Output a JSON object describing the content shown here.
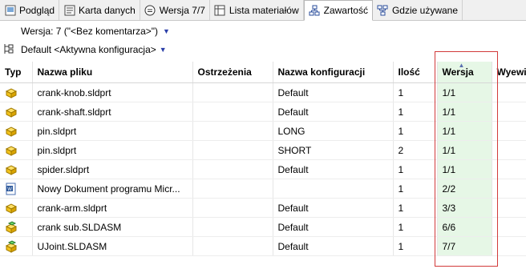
{
  "tabs": [
    {
      "label": "Podgląd",
      "icon": "preview-icon"
    },
    {
      "label": "Karta danych",
      "icon": "datacard-icon"
    },
    {
      "label": "Wersja 7/7",
      "icon": "version-icon"
    },
    {
      "label": "Lista materiałów",
      "icon": "bom-icon"
    },
    {
      "label": "Zawartość",
      "icon": "contains-icon",
      "active": true
    },
    {
      "label": "Gdzie używane",
      "icon": "where-used-icon"
    }
  ],
  "version_selector": {
    "label": "Wersja: 7 (\"<Bez komentarza>\")"
  },
  "config_selector": {
    "label": "Default <Aktywna konfiguracja>"
  },
  "columns": {
    "type": "Typ",
    "filename": "Nazwa pliku",
    "warnings": "Ostrzeżenia",
    "config": "Nazwa konfiguracji",
    "qty": "Ilość",
    "version": "Wersja",
    "checkout": "Wyewid"
  },
  "rows": [
    {
      "icon": "part-icon",
      "name": "crank-knob.sldprt",
      "warn": "",
      "config": "Default",
      "qty": "1",
      "version": "1/1"
    },
    {
      "icon": "part-icon",
      "name": "crank-shaft.sldprt",
      "warn": "",
      "config": "Default",
      "qty": "1",
      "version": "1/1"
    },
    {
      "icon": "part-icon",
      "name": "pin.sldprt",
      "warn": "",
      "config": "LONG",
      "qty": "1",
      "version": "1/1"
    },
    {
      "icon": "part-icon",
      "name": "pin.sldprt",
      "warn": "",
      "config": "SHORT",
      "qty": "2",
      "version": "1/1"
    },
    {
      "icon": "part-icon",
      "name": "spider.sldprt",
      "warn": "",
      "config": "Default",
      "qty": "1",
      "version": "1/1"
    },
    {
      "icon": "word-document-icon",
      "name": "Nowy Dokument programu Micr...",
      "warn": "",
      "config": "",
      "qty": "1",
      "version": "2/2"
    },
    {
      "icon": "part-icon",
      "name": "crank-arm.sldprt",
      "warn": "",
      "config": "Default",
      "qty": "1",
      "version": "3/3"
    },
    {
      "icon": "assembly-icon",
      "name": "crank sub.SLDASM",
      "warn": "",
      "config": "Default",
      "qty": "1",
      "version": "6/6"
    },
    {
      "icon": "assembly-icon",
      "name": "UJoint.SLDASM",
      "warn": "",
      "config": "Default",
      "qty": "1",
      "version": "7/7"
    }
  ],
  "colors": {
    "highlight_column": "#e6f7e6",
    "annotation_box": "#d23a3a"
  }
}
